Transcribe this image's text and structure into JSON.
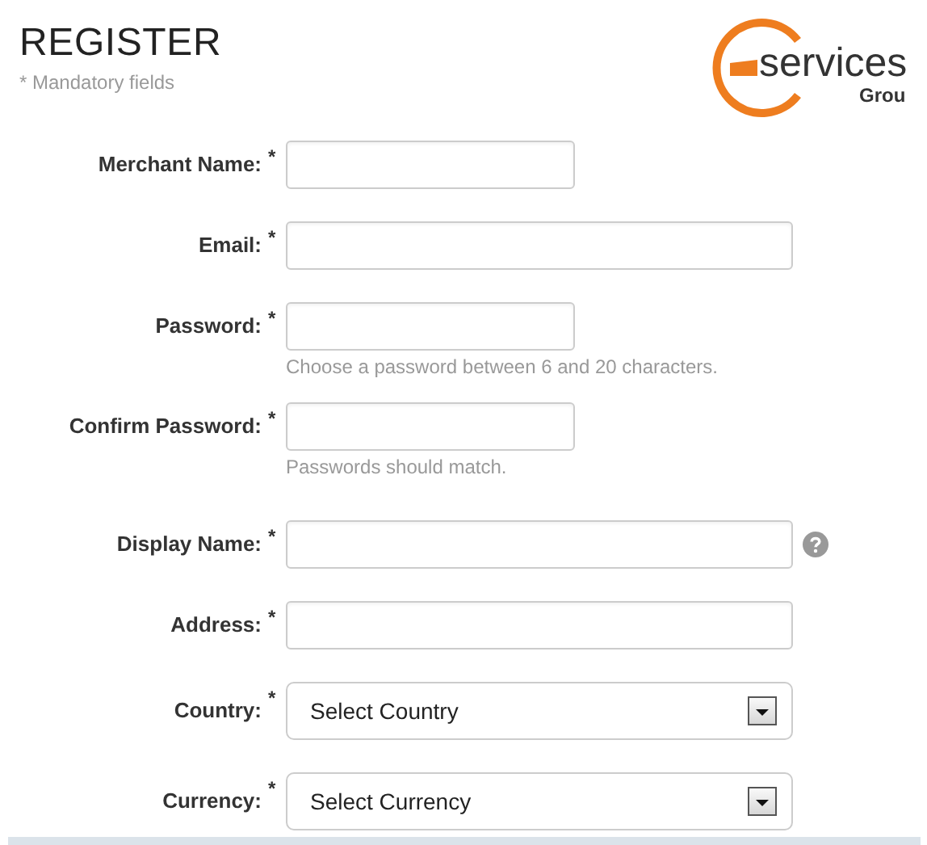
{
  "header": {
    "title": "REGISTER",
    "note": "* Mandatory fields"
  },
  "logo": {
    "word": "services",
    "sub": "Grou"
  },
  "sections": [
    {
      "fields": [
        {
          "label": "Merchant Name:",
          "mark": "*",
          "kind": "text",
          "wide": false
        },
        {
          "label": "Email:",
          "mark": "*",
          "kind": "text",
          "wide": true
        },
        {
          "label": "Password:",
          "mark": "*",
          "kind": "text",
          "wide": false,
          "hint": "Choose a password between 6 and 20 characters."
        },
        {
          "label": "Confirm Password:",
          "mark": "*",
          "kind": "text",
          "wide": false,
          "hint": "Passwords should match."
        }
      ]
    },
    {
      "fields": [
        {
          "label": "Display Name:",
          "mark": "*",
          "kind": "text",
          "wide": true,
          "help": true
        },
        {
          "label": "Address:",
          "mark": "*",
          "kind": "text",
          "wide": true
        },
        {
          "label": "Country:",
          "mark": "*",
          "kind": "select",
          "wide": true,
          "value": "Select Country"
        },
        {
          "label": "Currency:",
          "mark": "*",
          "kind": "select",
          "wide": true,
          "value": "Select Currency"
        }
      ]
    }
  ]
}
